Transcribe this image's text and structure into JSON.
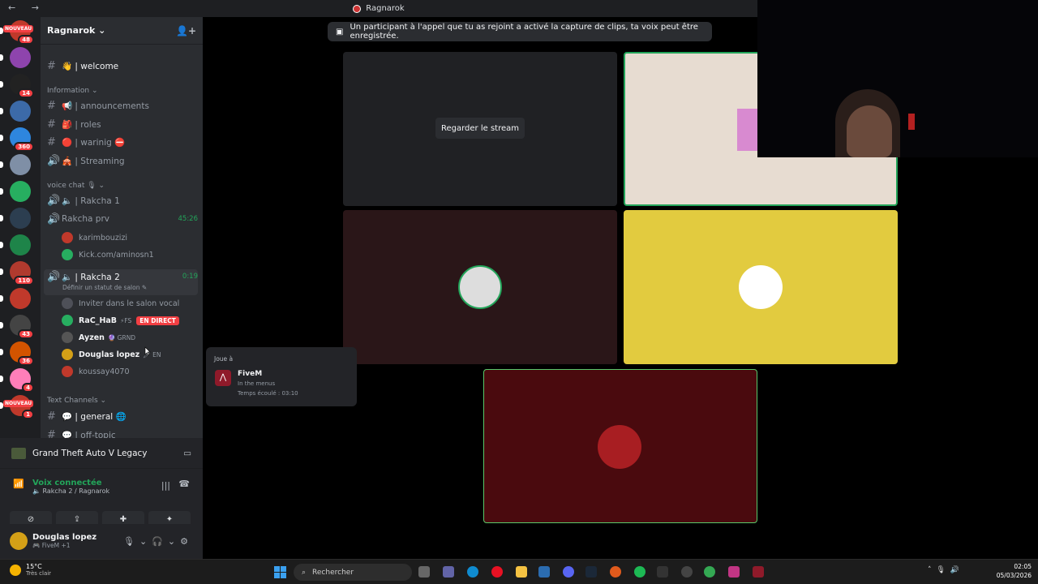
{
  "window": {
    "title": "Ragnarok",
    "nav": "← →"
  },
  "server": {
    "name": "Ragnarok"
  },
  "servers": [
    {
      "color": "#c0392b",
      "badge": "48",
      "new": "NOUVEAU"
    },
    {
      "color": "#8e44ad",
      "badge": ""
    },
    {
      "color": "#222222",
      "badge": "14"
    },
    {
      "color": "#3c6aa8",
      "badge": ""
    },
    {
      "color": "#2e86de",
      "badge": "360"
    },
    {
      "color": "#7f8fa6",
      "badge": ""
    },
    {
      "color": "#27ae60",
      "badge": ""
    },
    {
      "color": "#2c3e50",
      "badge": ""
    },
    {
      "color": "#1e8449",
      "badge": ""
    },
    {
      "color": "#b03a2e",
      "badge": "110"
    },
    {
      "color": "#c0392b",
      "badge": ""
    },
    {
      "color": "#444444",
      "badge": "43"
    },
    {
      "color": "#d35400",
      "badge": "36"
    },
    {
      "color": "#ff7eb9",
      "badge": "4"
    },
    {
      "color": "#c0392b",
      "badge": "1",
      "new": "NOUVEAU"
    }
  ],
  "channels": {
    "welcome": "👋 | welcome",
    "cat_information": "Information ⌄",
    "announcements": "📢 | announcements",
    "roles": "🎒 | roles",
    "warinig": "🔴 | warinig ⛔",
    "streaming": "🎪 | Streaming",
    "cat_voice": "voice chat 🎙 ⌄",
    "rakcha1": "🔈 | Rakcha 1",
    "rakcha_prv": "Rakcha prv",
    "rakcha_prv_time": "45:26",
    "rakcha2": "🔈 | Rakcha 2",
    "rakcha2_time": "0:19",
    "rakcha2_status": "Définir un statut de salon ✎",
    "cat_text": "Text Channels ⌄",
    "general": "💬 | general 🌐",
    "offtopic": "💬 | off-topic"
  },
  "prv_users": [
    {
      "name": "karimbouzizi",
      "color": "#c0392b"
    },
    {
      "name": "Kick.com/aminosn1",
      "color": "#27ae60"
    }
  ],
  "rakcha2_users": [
    {
      "name": "Inviter dans le salon vocal",
      "color": "#4e5058",
      "live": "",
      "tag": ""
    },
    {
      "name": "RaC_HaB",
      "color": "#27ae60",
      "live": "EN DIRECT",
      "tag": "⚡FS"
    },
    {
      "name": "Ayzen",
      "color": "#555",
      "live": "",
      "tag": "🔮 GRND"
    },
    {
      "name": "Douglas lopez",
      "color": "#d4a017",
      "live": "",
      "tag": "🖊 EN"
    },
    {
      "name": "koussay4070",
      "color": "#c0392b",
      "live": "",
      "tag": ""
    }
  ],
  "game_bar": {
    "title": "Grand Theft Auto V Legacy"
  },
  "voice": {
    "status": "Voix connectée",
    "location": "🔈 Rakcha 2 / Ragnarok"
  },
  "user": {
    "name": "Douglas lopez",
    "status": "🎮 FiveM +1"
  },
  "call": {
    "notice": "Un participant à l'appel que tu as rejoint a activé la capture de clips, ta voix peut être enregistrée.",
    "stream_button": "Regarder le stream"
  },
  "popup": {
    "label": "Joue à",
    "game": "FiveM",
    "detail": "In the menus",
    "elapsed": "Temps écoulé : 03:10"
  },
  "taskbar": {
    "temp": "15°C",
    "weather": "Très clair",
    "search": "Rechercher",
    "time": "02:05",
    "date": "05/03/2026"
  },
  "colors": {
    "accent_green": "#23a55a",
    "live_red": "#f23f43",
    "yellow_tile": "#e2cb3f",
    "maroon_tile": "#4a0a0e"
  }
}
